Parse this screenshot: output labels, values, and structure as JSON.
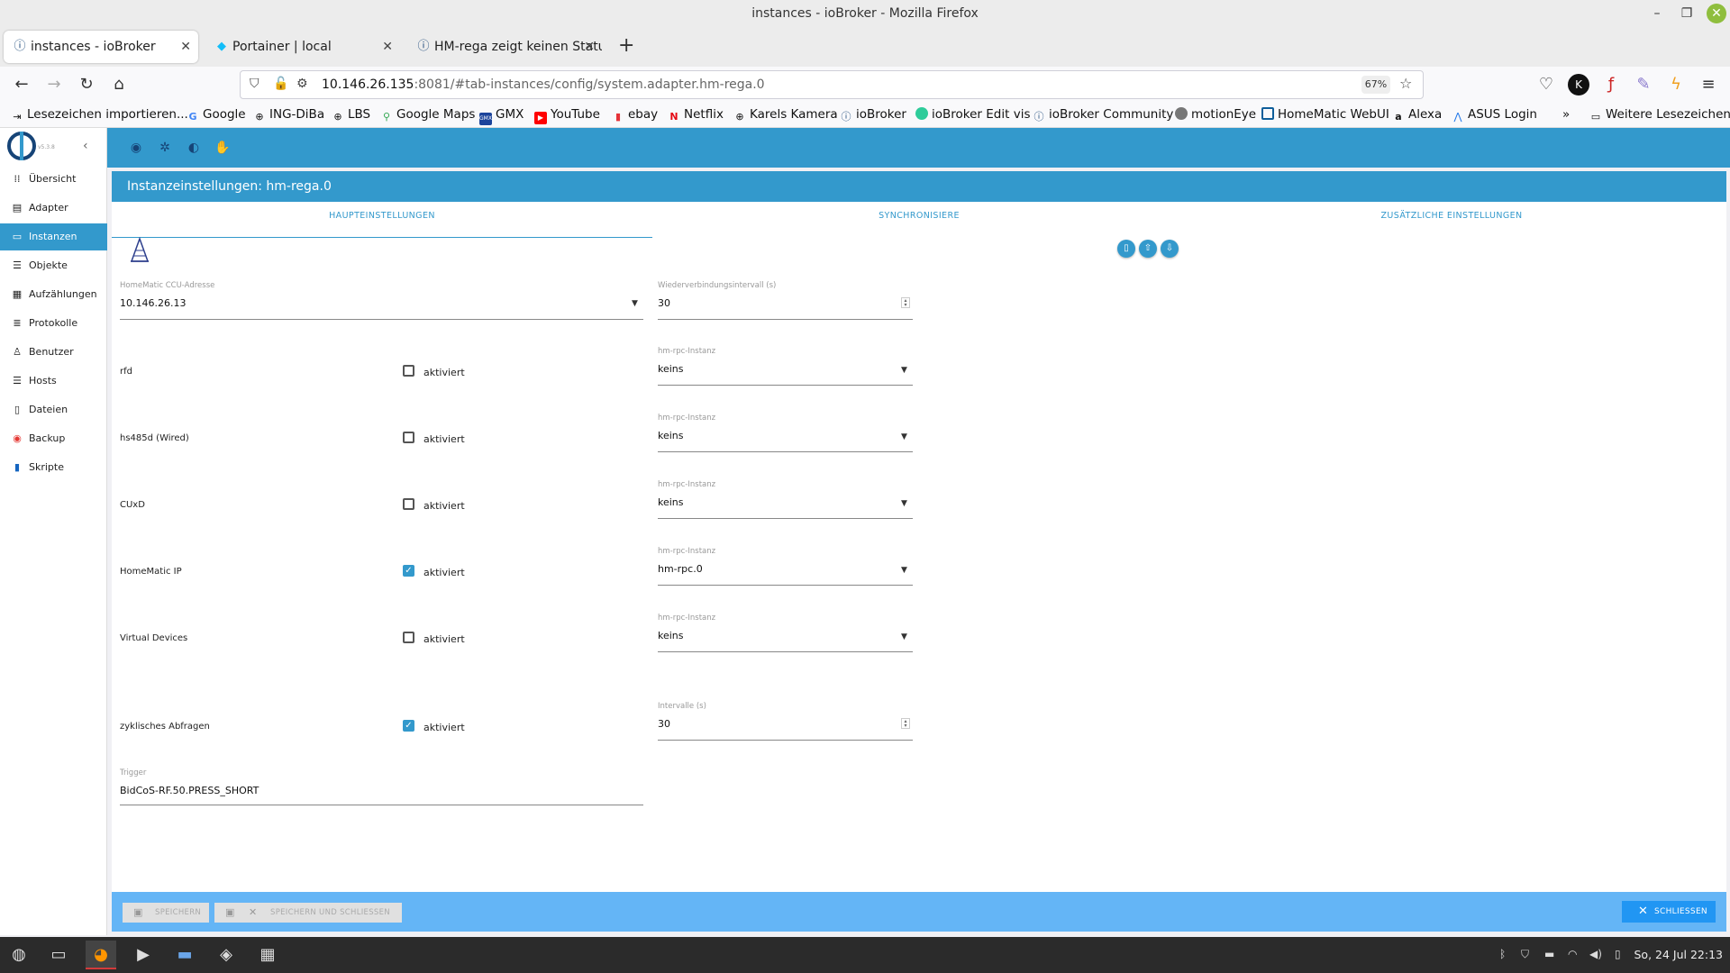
{
  "window": {
    "title": "instances - ioBroker - Mozilla Firefox",
    "controls": {
      "minimize": "–",
      "maximize": "❐",
      "close": "✕"
    }
  },
  "tabs": [
    {
      "title": "instances - ioBroker",
      "icon": "iobroker-icon",
      "active": true
    },
    {
      "title": "Portainer | local",
      "icon": "portainer-icon",
      "active": false
    },
    {
      "title": "HM-rega zeigt keinen Status",
      "icon": "iobroker-icon",
      "active": false
    }
  ],
  "newtab": "+",
  "navbar": {
    "url_host": "10.146.26.135",
    "url_rest": ":8081/#tab-instances/config/system.adapter.hm-rega.0",
    "zoom": "67%"
  },
  "bookmarks": [
    {
      "label": "Lesezeichen importieren...",
      "icon": "import-icon"
    },
    {
      "label": "Google",
      "icon": "google-icon"
    },
    {
      "label": "ING-DiBa",
      "icon": "globe-icon"
    },
    {
      "label": "LBS",
      "icon": "globe-icon"
    },
    {
      "label": "Google Maps",
      "icon": "maps-icon"
    },
    {
      "label": "GMX",
      "icon": "gmx-icon"
    },
    {
      "label": "YouTube",
      "icon": "youtube-icon"
    },
    {
      "label": "ebay",
      "icon": "ebay-icon"
    },
    {
      "label": "Netflix",
      "icon": "netflix-icon"
    },
    {
      "label": "Karels Kamera",
      "icon": "globe-icon"
    },
    {
      "label": "ioBroker",
      "icon": "iobroker-icon"
    },
    {
      "label": "ioBroker Edit vis",
      "icon": "vis-icon"
    },
    {
      "label": "ioBroker Community",
      "icon": "iobroker-icon"
    },
    {
      "label": "motionEye",
      "icon": "motioneye-icon"
    },
    {
      "label": "HomeMatic WebUI",
      "icon": "homematic-icon"
    },
    {
      "label": "Alexa",
      "icon": "amazon-icon"
    },
    {
      "label": "ASUS Login",
      "icon": "asus-icon"
    }
  ],
  "bookmarks_more": "Weitere Lesezeichen",
  "sidebar": {
    "version": "v5.3.8",
    "items": [
      {
        "label": "Übersicht",
        "icon": "grid-icon",
        "active": false
      },
      {
        "label": "Adapter",
        "icon": "store-icon",
        "active": false
      },
      {
        "label": "Instanzen",
        "icon": "instances-icon",
        "active": true
      },
      {
        "label": "Objekte",
        "icon": "list-icon",
        "active": false
      },
      {
        "label": "Aufzählungen",
        "icon": "enum-icon",
        "active": false
      },
      {
        "label": "Protokolle",
        "icon": "log-icon",
        "active": false
      },
      {
        "label": "Benutzer",
        "icon": "user-icon",
        "active": false
      },
      {
        "label": "Hosts",
        "icon": "hosts-icon",
        "active": false
      },
      {
        "label": "Dateien",
        "icon": "files-icon",
        "active": false
      },
      {
        "label": "Backup",
        "icon": "backup-icon",
        "active": false
      },
      {
        "label": "Skripte",
        "icon": "script-icon",
        "active": false
      }
    ]
  },
  "dialog": {
    "title": "Instanzeinstellungen: hm-rega.0",
    "tabs": [
      "HAUPTEINSTELLUNGEN",
      "SYNCHRONISIERE",
      "ZUSÄTZLICHE EINSTELLUNGEN"
    ],
    "ccu": {
      "label": "HomeMatic CCU-Adresse",
      "value": "10.146.26.13"
    },
    "reconnect": {
      "label": "Wiederverbindungsintervall (s)",
      "value": "30"
    },
    "rows": [
      {
        "name": "rfd",
        "checked": false,
        "check_label": "aktiviert",
        "field_label": "hm-rpc-Instanz",
        "field_value": "keins"
      },
      {
        "name": "hs485d (Wired)",
        "checked": false,
        "check_label": "aktiviert",
        "field_label": "hm-rpc-Instanz",
        "field_value": "keins"
      },
      {
        "name": "CUxD",
        "checked": false,
        "check_label": "aktiviert",
        "field_label": "hm-rpc-Instanz",
        "field_value": "keins"
      },
      {
        "name": "HomeMatic IP",
        "checked": true,
        "check_label": "aktiviert",
        "field_label": "hm-rpc-Instanz",
        "field_value": "hm-rpc.0"
      },
      {
        "name": "Virtual Devices",
        "checked": false,
        "check_label": "aktiviert",
        "field_label": "hm-rpc-Instanz",
        "field_value": "keins"
      }
    ],
    "polling": {
      "name": "zyklisches Abfragen",
      "checked": true,
      "check_label": "aktiviert",
      "field_label": "Intervalle (s)",
      "field_value": "30"
    },
    "trigger": {
      "label": "Trigger",
      "value": "BidCoS-RF.50.PRESS_SHORT"
    },
    "footer": {
      "save": "SPEICHERN",
      "save_close": "SPEICHERN UND SCHLIESSEN",
      "close": "SCHLIESSEN"
    }
  },
  "taskbar": {
    "clock": "So, 24 Jul 22:13"
  },
  "colors": {
    "accent": "#3399cc",
    "footer": "#64b5f6",
    "close_button": "#2196f3"
  }
}
